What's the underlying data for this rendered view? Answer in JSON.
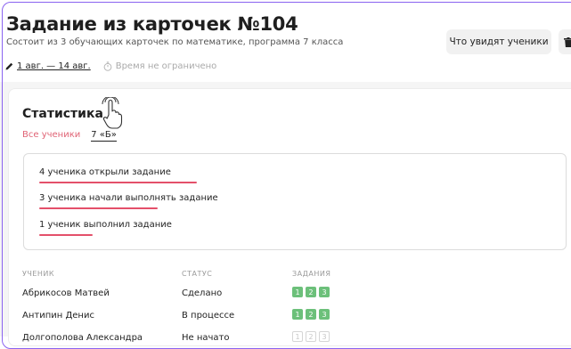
{
  "assignment": {
    "title": "Задание из карточек №104",
    "subtitle": "Состоит из 3 обучающих карточек по математике, программа 7 класса",
    "dates": "1 авг. — 14 авг.",
    "time_limit": "Время не ограничено",
    "preview_button": "Что увидят ученики"
  },
  "stats": {
    "title": "Статистика",
    "filter_all": "Все ученики",
    "filter_class": "7 «Б»",
    "lines": [
      {
        "text": "4 ученика открыли задание"
      },
      {
        "text": "3 ученика начали выполнять задание"
      },
      {
        "text": "1 ученик выполнил задание"
      }
    ]
  },
  "table": {
    "headers": {
      "student": "УЧЕНИК",
      "status": "СТАТУС",
      "tasks": "ЗАДАНИЯ"
    },
    "rows": [
      {
        "name": "Абрикосов Матвей",
        "status": "Сделано",
        "tasks": [
          {
            "n": "1",
            "state": "done"
          },
          {
            "n": "2",
            "state": "done"
          },
          {
            "n": "3",
            "state": "done"
          }
        ]
      },
      {
        "name": "Антипин Денис",
        "status": "В процессе",
        "tasks": [
          {
            "n": "1",
            "state": "done"
          },
          {
            "n": "2",
            "state": "done"
          },
          {
            "n": "3",
            "state": "done"
          }
        ]
      },
      {
        "name": "Долгополова Александра",
        "status": "Не начато",
        "tasks": [
          {
            "n": "1",
            "state": "todo"
          },
          {
            "n": "2",
            "state": "todo"
          },
          {
            "n": "3",
            "state": "todo"
          }
        ]
      }
    ]
  },
  "colors": {
    "accent_red": "#e06375",
    "underline_red": "#e4506a",
    "done_green": "#6cc07a",
    "frame_purple": "#8a63f0"
  },
  "icons": {
    "edit": "pencil-icon",
    "timer": "stopwatch-icon",
    "delete": "trash-icon",
    "cursor": "pointer-hand-icon"
  }
}
